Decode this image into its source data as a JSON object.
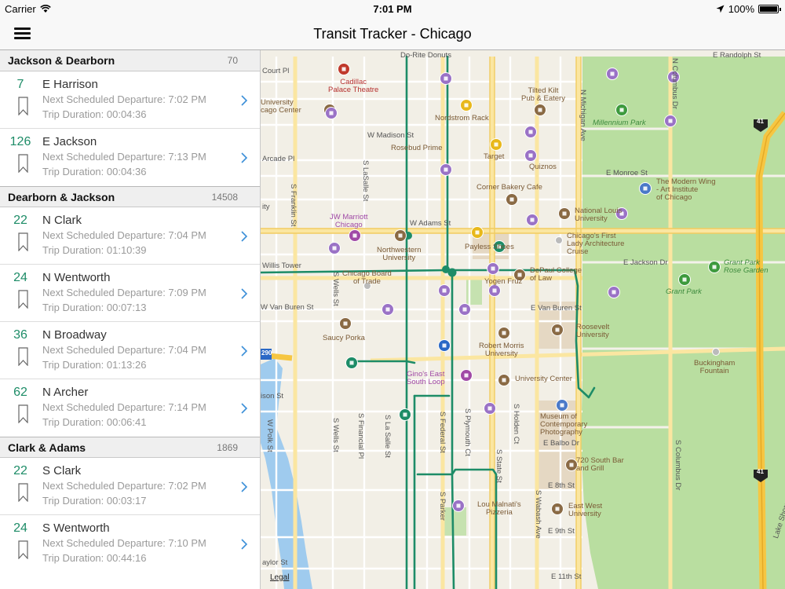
{
  "status_bar": {
    "carrier": "Carrier",
    "time": "7:01 PM",
    "battery": "100%",
    "battery_level": 1.0
  },
  "nav_bar": {
    "title": "Transit Tracker - Chicago",
    "menu_icon": "hamburger-menu-icon"
  },
  "sidebar": {
    "sections": [
      {
        "title": "Jackson & Dearborn",
        "id": "70",
        "routes": [
          {
            "number": "7",
            "name": "E Harrison",
            "next": "Next Scheduled Departure: 7:02 PM",
            "trip": "Trip Duration: 00:04:36"
          },
          {
            "number": "126",
            "name": "E Jackson",
            "next": "Next Scheduled Departure: 7:13 PM",
            "trip": "Trip Duration: 00:04:36"
          }
        ]
      },
      {
        "title": "Dearborn & Jackson",
        "id": "14508",
        "routes": [
          {
            "number": "22",
            "name": "N Clark",
            "next": "Next Scheduled Departure: 7:04 PM",
            "trip": "Trip Duration: 01:10:39"
          },
          {
            "number": "24",
            "name": "N Wentworth",
            "next": "Next Scheduled Departure: 7:09 PM",
            "trip": "Trip Duration: 00:07:13"
          },
          {
            "number": "36",
            "name": "N Broadway",
            "next": "Next Scheduled Departure: 7:04 PM",
            "trip": "Trip Duration: 01:13:26"
          },
          {
            "number": "62",
            "name": "N Archer",
            "next": "Next Scheduled Departure: 7:14 PM",
            "trip": "Trip Duration: 00:06:41"
          }
        ]
      },
      {
        "title": "Clark & Adams",
        "id": "1869",
        "routes": [
          {
            "number": "22",
            "name": "S Clark",
            "next": "Next Scheduled Departure: 7:02 PM",
            "trip": "Trip Duration: 00:03:17"
          },
          {
            "number": "24",
            "name": "S Wentworth",
            "next": "Next Scheduled Departure: 7:10 PM",
            "trip": "Trip Duration: 00:44:16"
          }
        ]
      }
    ]
  },
  "map": {
    "legal": "Legal",
    "colors": {
      "route": "#1d8c67",
      "park": "#b9dea0",
      "major_road": "#fbe6a1",
      "water": "#9fcbee",
      "accent": "#1d8c67"
    },
    "labels": {
      "randolph": "E Randolph St",
      "court_pl": "Court Pl",
      "donuts": "Do-Rite Donuts",
      "cadillac": "Cadillac\nPalace Theatre",
      "university": "University\ncago Center",
      "tilted_kilt": "Tilted Kilt\nPub & Eatery",
      "nordstrom": "Nordstrom Rack",
      "madison": "W Madison St",
      "rosebud": "Rosebud Prime",
      "target": "Target",
      "quiznos": "Quiznos",
      "arcade": "Arcade Pl",
      "millennium": "Millennium Park",
      "monroe": "E Monroe St",
      "modern_wing": "The Modern Wing\n- Art Institute\nof Chicago",
      "corner_bakery": "Corner Bakery Cafe",
      "national_louis": "National Louis\nUniversity",
      "jw_marriott": "JW Marriott\nChicago",
      "adams": "W Adams St",
      "payless": "Payless Shoes",
      "first_lady": "Chicago's First\nLady Architecture\nCruise",
      "northwestern": "Northwestern\nUniversity",
      "willis": "Willis Tower",
      "jackson": "E Jackson Dr",
      "board_trade": "Chicago Board\nof Trade",
      "depaul": "DePaul College\nof Law",
      "grant_rose": "Grant Park\nRose Garden",
      "grant_park": "Grant Park",
      "yogen": "Yogen Fruz",
      "van_buren_w": "W Van Buren St",
      "van_buren_e": "E Van Buren St",
      "roosevelt": "Roosevelt\nUniversity",
      "saucy": "Saucy Porka",
      "robert_morris": "Robert Morris\nUniversity",
      "buckingham": "Buckingham\nFountain",
      "ginos": "Gino's East\nSouth Loop",
      "university_center": "University Center",
      "ison": "ison St",
      "museum": "Museum of\nContemporary\nPhotography",
      "bar_720": "720 South Bar\nand Grill",
      "balbo": "E Balbo Dr",
      "e8th": "E 8th St",
      "east_west": "East West\nUniversity",
      "lou": "Lou Malnati's\nPizzeria",
      "e9th": "E 9th St",
      "e11th": "E 11th St",
      "taylor": "aylor St",
      "ity": "ity",
      "franklin": "S Franklin St",
      "wells_n": "S Wells St",
      "wells_s": "S Wells St",
      "lasalle_n": "S LaSalle St",
      "lasalle_s": "S La Salle St",
      "financial": "S Financial Pl",
      "federal": "S Federal St",
      "plymouth": "S Plymouth Ct",
      "holden": "S Holden Ct",
      "state": "S State St",
      "wabash": "S Wabash Ave",
      "michigan": "N Michigan Ave",
      "columbus_n": "N Columbus Dr",
      "columbus_s": "S Columbus Dr",
      "parker": "S Parker",
      "polk": "W Polk St",
      "shore": "Lake Shore Dr",
      "hwy41": "41",
      "hwy290": "290"
    }
  }
}
